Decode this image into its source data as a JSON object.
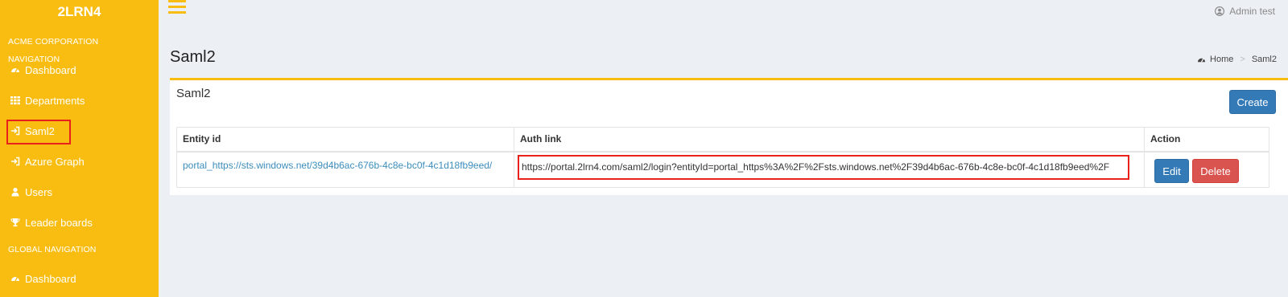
{
  "app": {
    "brand": "2LRN4"
  },
  "sidebar": {
    "header_acme": "ACME CORPORATION NAVIGATION",
    "items": [
      {
        "label": "Dashboard",
        "icon": "dashboard-icon"
      },
      {
        "label": "Departments",
        "icon": "grid-icon"
      },
      {
        "label": "Saml2",
        "icon": "sign-in-icon"
      },
      {
        "label": "Azure Graph",
        "icon": "sign-in-icon"
      },
      {
        "label": "Users",
        "icon": "user-icon"
      },
      {
        "label": "Leader boards",
        "icon": "trophy-icon"
      }
    ],
    "header_global": "GLOBAL NAVIGATION",
    "global_items": [
      {
        "label": "Dashboard",
        "icon": "dashboard-icon"
      }
    ]
  },
  "topbar": {
    "user_name": "Admin test"
  },
  "page": {
    "title": "Saml2",
    "breadcrumb": {
      "home": "Home",
      "separator": ">",
      "current": "Saml2"
    }
  },
  "box": {
    "title": "Saml2",
    "create_label": "Create",
    "table": {
      "headers": [
        "Entity id",
        "Auth link",
        "Action"
      ],
      "rows": [
        {
          "entity_id": "portal_https://sts.windows.net/39d4b6ac-676b-4c8e-bc0f-4c1d18fb9eed/",
          "auth_link": "https://portal.2lrn4.com/saml2/login?entityId=portal_https%3A%2F%2Fsts.windows.net%2F39d4b6ac-676b-4c8e-bc0f-4c1d18fb9eed%2F",
          "edit_label": "Edit",
          "delete_label": "Delete"
        }
      ]
    }
  },
  "colors": {
    "accent": "#f9bd12",
    "primary": "#337ab7",
    "danger": "#d9534f",
    "highlight": "#e8211c"
  }
}
